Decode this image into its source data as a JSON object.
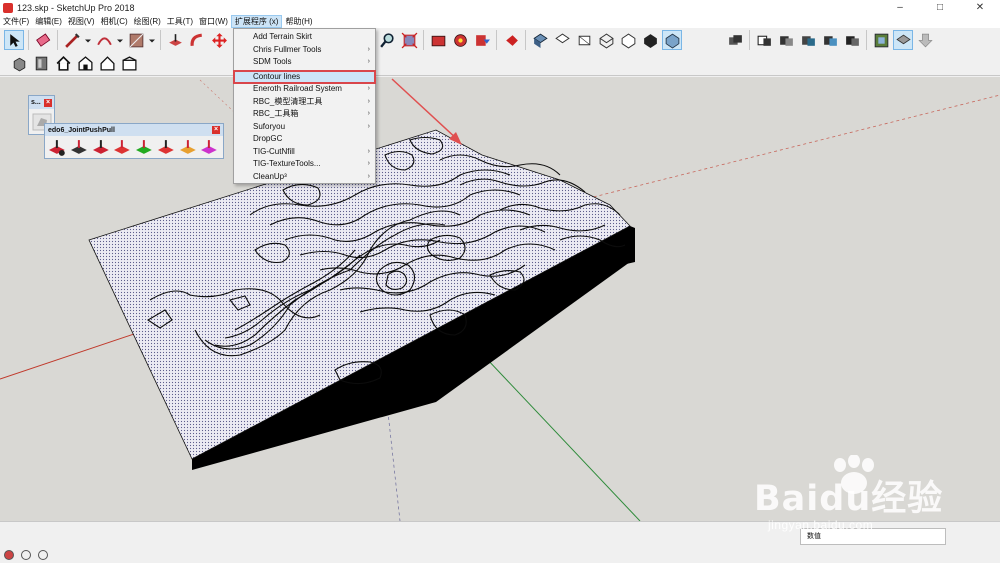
{
  "window": {
    "title": "123.skp - SketchUp Pro 2018",
    "controls": [
      "–",
      "□",
      "✕"
    ]
  },
  "menubar": {
    "items": [
      "文件(F)",
      "编辑(E)",
      "视图(V)",
      "相机(C)",
      "绘图(R)",
      "工具(T)",
      "窗口(W)",
      "扩展程序 (x)",
      "帮助(H)"
    ],
    "active_index": 7
  },
  "extensions_menu": {
    "items": [
      {
        "label": "Add Terrain Skirt",
        "submenu": false
      },
      {
        "label": "Chris Fullmer Tools",
        "submenu": true
      },
      {
        "label": "SDM Tools",
        "submenu": true
      },
      {
        "label": "Contour lines",
        "submenu": false,
        "highlighted": true
      },
      {
        "label": "Eneroth Railroad System",
        "submenu": true
      },
      {
        "label": "RBC_模型清理工具",
        "submenu": true
      },
      {
        "label": "RBC_工具箱",
        "submenu": true
      },
      {
        "label": "Suforyou",
        "submenu": true
      },
      {
        "label": "DropGC",
        "submenu": false
      },
      {
        "label": "TIG-CutNfill",
        "submenu": true
      },
      {
        "label": "TIG-TextureTools...",
        "submenu": true
      },
      {
        "label": "CleanUp³",
        "submenu": true
      }
    ]
  },
  "panels": {
    "small_title": "s...",
    "joint_title": "edo6_JointPushPull"
  },
  "statusbar": {
    "measurements_label": "数值"
  },
  "watermark": {
    "logo_text": "Baidu经验",
    "url": "jingyan.baidu.com"
  },
  "colors": {
    "menu_highlight": "#cde4f7",
    "highlight_box": "#d9464b",
    "viewport_bg": "#d9d8d4",
    "terrain_top": "#e6e3ef",
    "terrain_side": "#000000",
    "axis_red": "#c0392b",
    "axis_green": "#2e8b3a",
    "annotation_arrow": "#e05050"
  }
}
